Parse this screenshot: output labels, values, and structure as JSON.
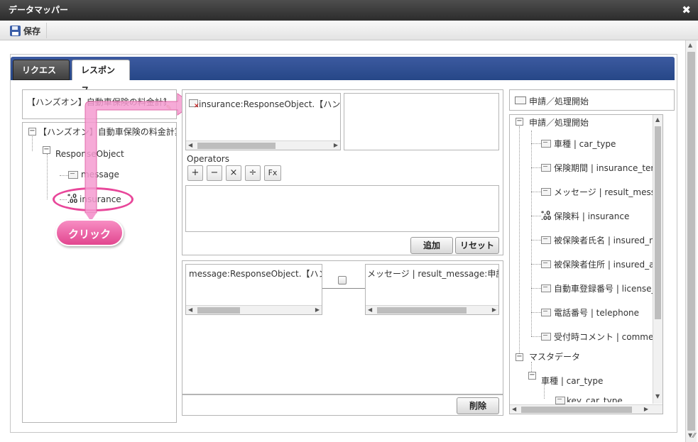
{
  "window": {
    "title": "データマッパー",
    "close_icon": "close-icon"
  },
  "toolbar": {
    "save_label": "保存",
    "save_icon": "floppy-disk-icon"
  },
  "tabs": [
    {
      "label": "リクエスト",
      "active": false
    },
    {
      "label": "レスポンス",
      "active": true
    }
  ],
  "left_panel": {
    "search_value": "【ハンズオン】自動車保険の料金計算",
    "tree": {
      "root_label": "【ハンズオン】自動車保険の料金計算",
      "child_label": "ResponseObject",
      "items": [
        "message",
        "insurance"
      ]
    }
  },
  "callout": {
    "label": "クリック",
    "color": "#e8479a"
  },
  "middle": {
    "expression_source": "insurance:ResponseObject.【ハンズオ",
    "operators_label": "Operators",
    "operators": [
      "+",
      "−",
      "×",
      "÷",
      "Fx"
    ],
    "add_button": "追加",
    "reset_button": "リセット",
    "mapping_source": "message:ResponseObject.【ハンズ",
    "mapping_target": "メッセージ | result_message:申請／",
    "delete_button": "削除"
  },
  "right_panel": {
    "header_label": "申請／処理開始",
    "tree_root": "申請／処理開始",
    "items": [
      "車種 | car_type",
      "保険期間 | insurance_term",
      "メッセージ | result_message",
      "保険料 | insurance",
      "被保険者氏名 | insured_name",
      "被保険者住所 | insured_address",
      "自動車登録番号 | license_number",
      "電話番号 | telephone",
      "受付時コメント | comment"
    ],
    "master_label": "マスタデータ",
    "master_child": "車種 | car_type",
    "master_grandchild": "key_car_type"
  },
  "colors": {
    "tab_bar": "#2f4e93",
    "accent_pink": "#e8479a"
  }
}
